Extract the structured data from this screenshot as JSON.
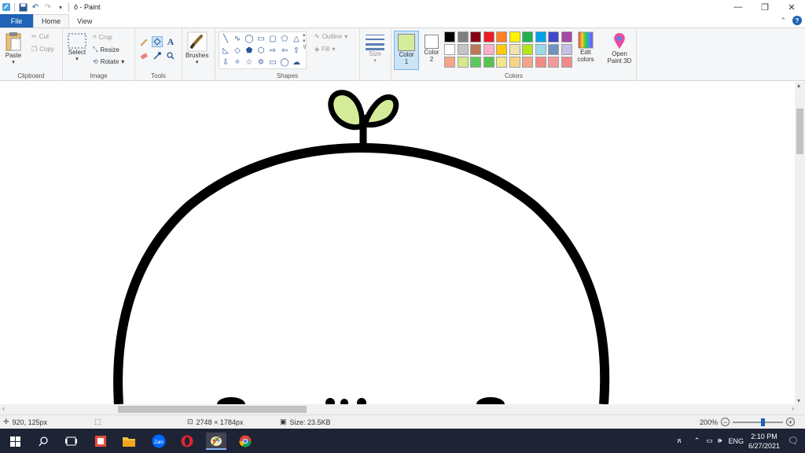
{
  "window": {
    "title": "ô - Paint",
    "buttons": {
      "minimize": "—",
      "maximize": "❐",
      "close": "✕"
    }
  },
  "tabs": [
    {
      "label": "File"
    },
    {
      "label": "Home"
    },
    {
      "label": "View"
    }
  ],
  "ribbon": {
    "clipboard": {
      "group": "Clipboard",
      "paste": "Paste",
      "cut": "Cut",
      "copy": "Copy"
    },
    "image": {
      "group": "Image",
      "select": "Select",
      "crop": "Crop",
      "resize": "Resize",
      "rotate": "Rotate"
    },
    "tools": {
      "group": "Tools"
    },
    "brushes": {
      "label": "Brushes"
    },
    "shapes": {
      "group": "Shapes",
      "outline": "Outline",
      "fill": "Fill"
    },
    "size": {
      "label": "Size"
    },
    "colors": {
      "group": "Colors",
      "color1": "Color\n1",
      "color2": "Color\n2",
      "color1_label": "Color",
      "color1_num": "1",
      "color2_label": "Color",
      "color2_num": "2",
      "edit": "Edit",
      "edit2": "colors",
      "color1_value": "#d4ec9a",
      "color2_value": "#ffffff",
      "palette": [
        "#000000",
        "#7f7f7f",
        "#880015",
        "#ed1c24",
        "#ff7f27",
        "#fff200",
        "#22b14c",
        "#00a2e8",
        "#3f48cc",
        "#a349a4",
        "#ffffff",
        "#c3c3c3",
        "#b97a57",
        "#ffaec9",
        "#ffc90e",
        "#efe4b0",
        "#b5e61d",
        "#99d9ea",
        "#7092be",
        "#c8bfe7",
        "#f4a58a",
        "#d5e98b",
        "#5ec95a",
        "#58c24f",
        "#f0e68c",
        "#f6d58b",
        "#f4a58a",
        "#f08c82",
        "#f39b9b",
        "#f18b8b"
      ]
    },
    "paint3d": {
      "line1": "Open",
      "line2": "Paint 3D"
    }
  },
  "status": {
    "cursor": "920, 125px",
    "dimensions": "2748 × 1784px",
    "size": "Size: 23.5KB",
    "zoom": "200%"
  },
  "taskbar": {
    "lang": "ENG",
    "time": "2:10 PM",
    "date": "6/27/2021",
    "zalo": "Zalo"
  }
}
